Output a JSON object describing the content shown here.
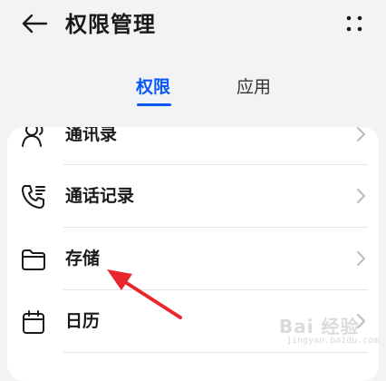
{
  "header": {
    "title": "权限管理",
    "back_icon": "arrow-left-icon",
    "more_icon": "more-dots-icon"
  },
  "tabs": [
    {
      "label": "权限",
      "active": true
    },
    {
      "label": "应用",
      "active": false
    }
  ],
  "permissions": {
    "items": [
      {
        "label": "通讯录",
        "icon": "contacts-icon"
      },
      {
        "label": "通话记录",
        "icon": "call-log-icon"
      },
      {
        "label": "存储",
        "icon": "folder-icon"
      },
      {
        "label": "日历",
        "icon": "calendar-icon"
      }
    ]
  },
  "annotation": {
    "type": "red-arrow",
    "target": "存储"
  },
  "watermark": {
    "text": "Bai 经验",
    "sub": "jingyan.baidu.com"
  },
  "colors": {
    "accent": "#0a59f7",
    "background": "#f1f3f5",
    "card": "#ffffff",
    "arrow": "#e8262b"
  }
}
